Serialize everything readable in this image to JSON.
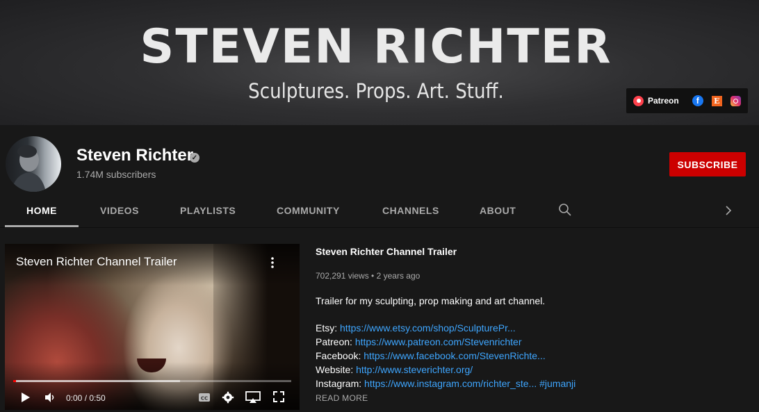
{
  "banner": {
    "title": "STEVEN RICHTER",
    "tagline": "Sculptures. Props. Art. Stuff.",
    "links": {
      "patreon_label": "Patreon",
      "facebook_glyph": "f",
      "etsy_glyph": "E"
    }
  },
  "channel": {
    "name": "Steven Richter",
    "subscribers": "1.74M subscribers",
    "subscribe_label": "SUBSCRIBE"
  },
  "tabs": [
    {
      "label": "HOME",
      "active": true
    },
    {
      "label": "VIDEOS"
    },
    {
      "label": "PLAYLISTS"
    },
    {
      "label": "COMMUNITY"
    },
    {
      "label": "CHANNELS"
    },
    {
      "label": "ABOUT"
    }
  ],
  "player": {
    "overlay_title": "Steven Richter Channel Trailer",
    "time": "0:00 / 0:50",
    "buffered_fraction": 0.6,
    "played_fraction": 0.01
  },
  "video": {
    "title": "Steven Richter Channel Trailer",
    "meta": "702,291 views • 2 years ago",
    "description": "Trailer for my sculpting, prop making and art channel.",
    "links": [
      {
        "key": "Etsy:",
        "url": "https://www.etsy.com/shop/SculpturePr..."
      },
      {
        "key": "Patreon:",
        "url": "https://www.patreon.com/Stevenrichter"
      },
      {
        "key": "Facebook:",
        "url": "https://www.facebook.com/StevenRichte..."
      },
      {
        "key": "Website:",
        "url": "http://www.steverichter.org/"
      },
      {
        "key": "Instagram:",
        "url": "https://www.instagram.com/richter_ste...",
        "hashtag": "#jumanji"
      }
    ],
    "read_more": "READ MORE"
  },
  "colors": {
    "brand_red": "#cc0000",
    "link_blue": "#3ea6ff",
    "background": "#181818"
  },
  "icons": [
    "patreon-icon",
    "facebook-icon",
    "etsy-icon",
    "instagram-icon",
    "verified-icon",
    "search-icon",
    "chevron-right-icon",
    "more-vert-icon",
    "play-icon",
    "volume-icon",
    "captions-icon",
    "settings-icon",
    "airplay-icon",
    "fullscreen-icon"
  ]
}
